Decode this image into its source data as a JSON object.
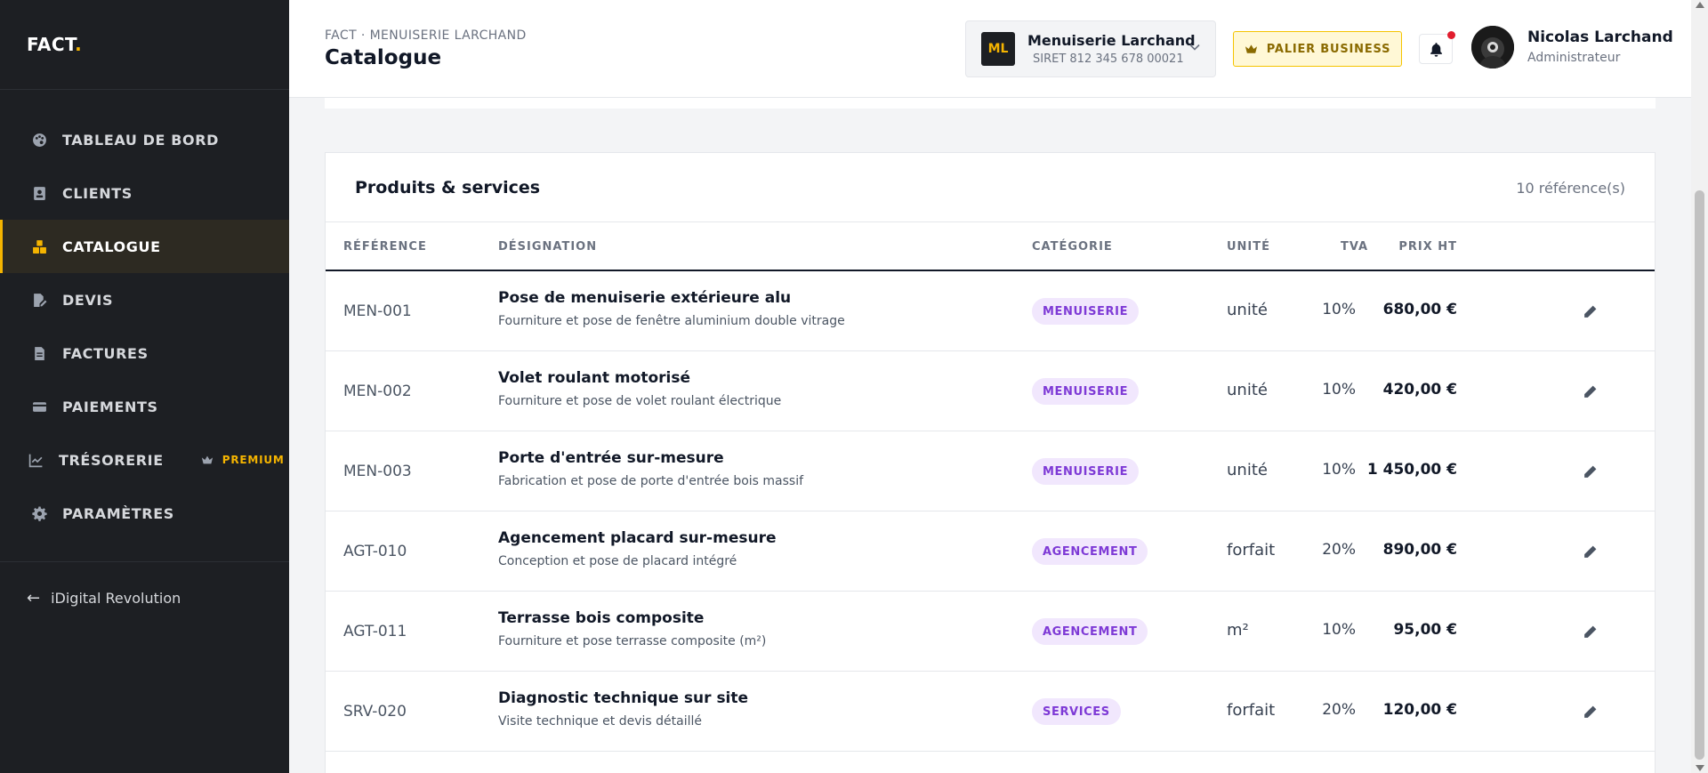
{
  "brand": {
    "name": "FACT",
    "dot": "."
  },
  "sidebar": {
    "items": [
      {
        "label": "TABLEAU DE BORD",
        "icon": "palette-icon"
      },
      {
        "label": "CLIENTS",
        "icon": "address-book-icon"
      },
      {
        "label": "CATALOGUE",
        "icon": "boxes-icon",
        "active": true
      },
      {
        "label": "DEVIS",
        "icon": "file-signature-icon"
      },
      {
        "label": "FACTURES",
        "icon": "invoice-icon"
      },
      {
        "label": "PAIEMENTS",
        "icon": "credit-card-icon"
      },
      {
        "label": "TRÉSORERIE",
        "icon": "chart-line-icon",
        "badge": "PREMIUM"
      },
      {
        "label": "PARAMÈTRES",
        "icon": "gear-icon"
      }
    ],
    "back_link": "iDigital Revolution"
  },
  "header": {
    "breadcrumb": "FACT · MENUISERIE LARCHAND",
    "title": "Catalogue",
    "company": {
      "initials": "ML",
      "name": "Menuiserie Larchand",
      "siret": "SIRET 812 345 678 00021"
    },
    "tier": "PALIER BUSINESS",
    "user": {
      "name": "Nicolas Larchand",
      "role": "Administrateur"
    }
  },
  "catalog": {
    "title": "Produits & services",
    "count": "10 référence(s)",
    "columns": [
      "RÉFÉRENCE",
      "DÉSIGNATION",
      "CATÉGORIE",
      "UNITÉ",
      "PRIX HT",
      "TVA"
    ],
    "rows": [
      {
        "ref": "MEN-001",
        "title": "Pose de menuiserie extérieure alu",
        "desc": "Fourniture et pose de fenêtre aluminium double vitrage",
        "category": "MENUISERIE",
        "unit": "unité",
        "price": "680,00 €",
        "tva": "10%"
      },
      {
        "ref": "MEN-002",
        "title": "Volet roulant motorisé",
        "desc": "Fourniture et pose de volet roulant électrique",
        "category": "MENUISERIE",
        "unit": "unité",
        "price": "420,00 €",
        "tva": "10%"
      },
      {
        "ref": "MEN-003",
        "title": "Porte d'entrée sur-mesure",
        "desc": "Fabrication et pose de porte d'entrée bois massif",
        "category": "MENUISERIE",
        "unit": "unité",
        "price": "1 450,00 €",
        "tva": "10%"
      },
      {
        "ref": "AGT-010",
        "title": "Agencement placard sur-mesure",
        "desc": "Conception et pose de placard intégré",
        "category": "AGENCEMENT",
        "unit": "forfait",
        "price": "890,00 €",
        "tva": "20%"
      },
      {
        "ref": "AGT-011",
        "title": "Terrasse bois composite",
        "desc": "Fourniture et pose terrasse composite (m²)",
        "category": "AGENCEMENT",
        "unit": "m²",
        "price": "95,00 €",
        "tva": "10%"
      },
      {
        "ref": "SRV-020",
        "title": "Diagnostic technique sur site",
        "desc": "Visite technique et devis détaillé",
        "category": "SERVICES",
        "unit": "forfait",
        "price": "120,00 €",
        "tva": "20%"
      }
    ]
  },
  "colors": {
    "accent": "#f5b400",
    "sidebar_bg": "#1d1f23",
    "badge_bg": "#f1e7fd",
    "badge_text": "#7e3ad6",
    "notification": "#e11d2e"
  }
}
